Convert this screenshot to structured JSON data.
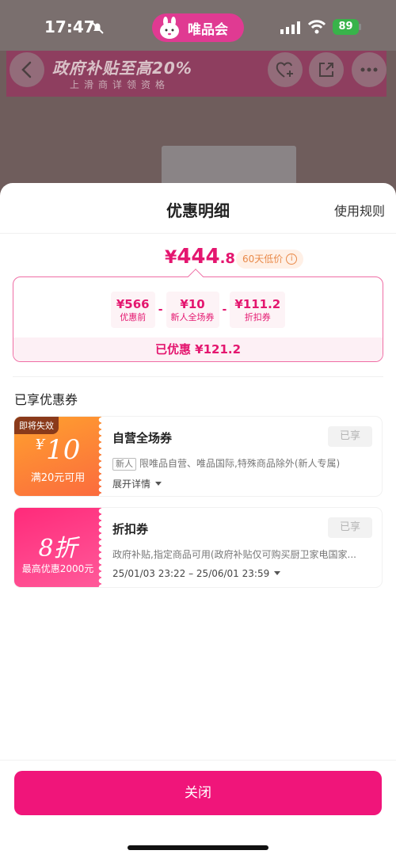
{
  "status_bar": {
    "time": "17:47",
    "battery": "89",
    "brand": "唯品会"
  },
  "background_page": {
    "promo_title": "政府补贴至高20%",
    "promo_subtitle": "上滑商详领资格"
  },
  "sheet": {
    "title": "优惠明细",
    "rules_link": "使用规则",
    "price": {
      "symbol": "¥",
      "integer": "444",
      "decimal": ".8",
      "badge": "60天低价"
    },
    "breakdown": {
      "items": [
        {
          "value": "¥566",
          "label": "优惠前"
        },
        {
          "value": "¥10",
          "label": "新人全场券"
        },
        {
          "value": "¥111.2",
          "label": "折扣券"
        }
      ],
      "operators": [
        "-",
        "-"
      ],
      "saved": "已优惠 ¥121.2"
    },
    "section_title": "已享优惠券",
    "coupons": [
      {
        "expire_tag": "即将失效",
        "amount_symbol": "¥",
        "amount": "10",
        "condition": "满20元可用",
        "name": "自营全场券",
        "status": "已享",
        "new_tag": "新人",
        "description": "限唯品自营、唯品国际,特殊商品除外(新人专属)",
        "expand": "展开详情"
      },
      {
        "amount": "8折",
        "condition": "最高优惠2000元",
        "name": "折扣券",
        "status": "已享",
        "description": "政府补贴,指定商品可用(政府补贴仅可购买厨卫家电国家...",
        "validity": "25/01/03 23:22 – 25/06/01 23:59"
      }
    ],
    "close_button": "关闭"
  },
  "colors": {
    "accent": "#e4166f",
    "button": "#f0157a",
    "coupon_orange": "#fb6b3e",
    "coupon_pink": "#ff2a7a"
  }
}
